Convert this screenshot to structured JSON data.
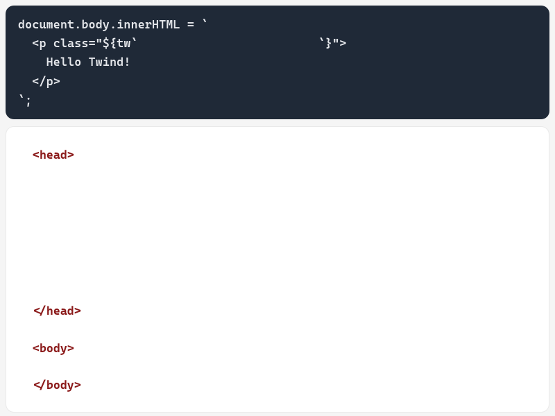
{
  "code": {
    "line1": "document.body.innerHTML = `",
    "line2a": "  <p class=\"${tw`",
    "line2b": "`}\">",
    "line3": "    Hello Twind!",
    "line4": "  </p>",
    "line5": "`;"
  },
  "output": {
    "head_open": "<head>",
    "head_close": "</head>",
    "body_open": "<body>",
    "body_close": "</body>"
  }
}
